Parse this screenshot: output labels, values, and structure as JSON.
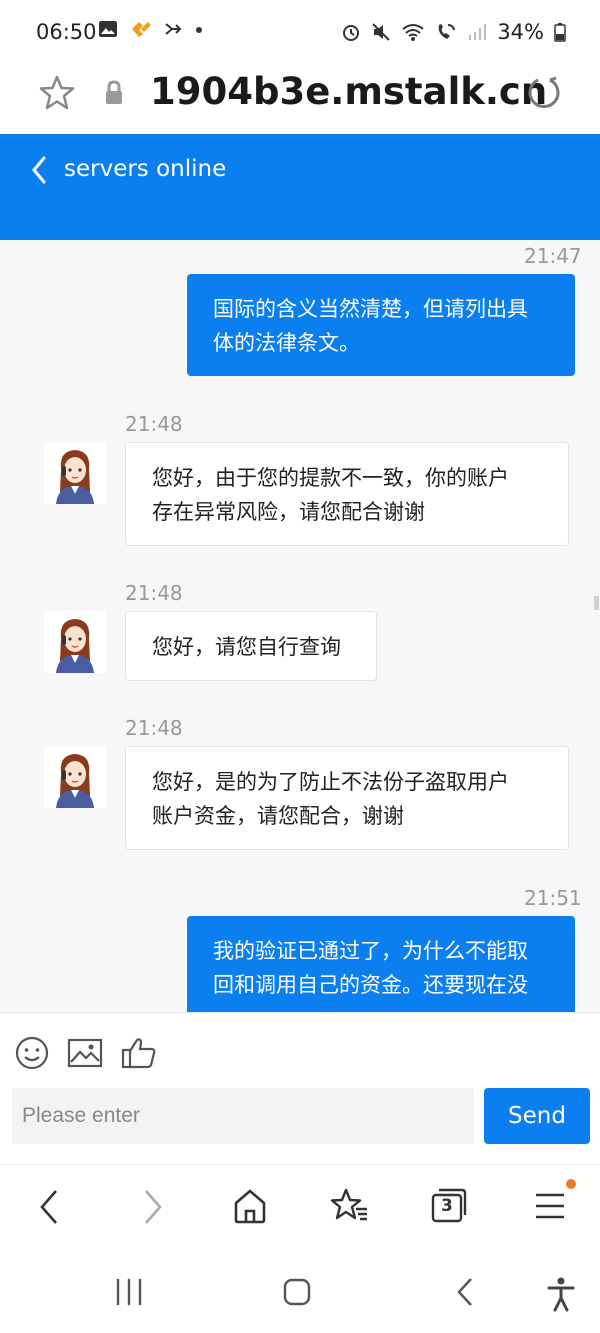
{
  "status_bar": {
    "time": "06:50",
    "battery": "34%",
    "icons": [
      "gallery-icon",
      "app-icon",
      "network-icon",
      "dot-icon",
      "alarm-icon",
      "mute-icon",
      "wifi-icon",
      "wifi-call-icon",
      "signal-icon",
      "battery-icon"
    ]
  },
  "browser": {
    "url": "1904b3e.mstalk.cn"
  },
  "chat_header": {
    "title": "servers online"
  },
  "messages": [
    {
      "from": "user",
      "time": "21:47",
      "text_lines": [
        "国际的含义当然清楚，但请列出具",
        "体的法律条文。"
      ]
    },
    {
      "from": "agent",
      "time": "21:48",
      "text_lines": [
        "您好，由于您的提款不一致，你的账户",
        "存在异常风险，请您配合谢谢"
      ]
    },
    {
      "from": "agent",
      "time": "21:48",
      "text_lines": [
        "您好，请您自行查询"
      ]
    },
    {
      "from": "agent",
      "time": "21:48",
      "text_lines": [
        "您好，是的为了防止不法份子盗取用户",
        "账户资金，请您配合，谢谢"
      ]
    },
    {
      "from": "user",
      "time": "21:51",
      "text_lines": [
        "我的验证已通过了，为什么不能取",
        "回和调用自己的资金。还要现在没"
      ]
    }
  ],
  "composer": {
    "placeholder": "Please enter",
    "send_label": "Send",
    "tools": [
      "emoji-icon",
      "image-icon",
      "thumbs-up-icon"
    ]
  },
  "browser_nav": {
    "tab_count": "3"
  },
  "colors": {
    "accent": "#0b7ff0",
    "chat_bg": "#f7f7f7",
    "notification": "#f07a2a"
  }
}
